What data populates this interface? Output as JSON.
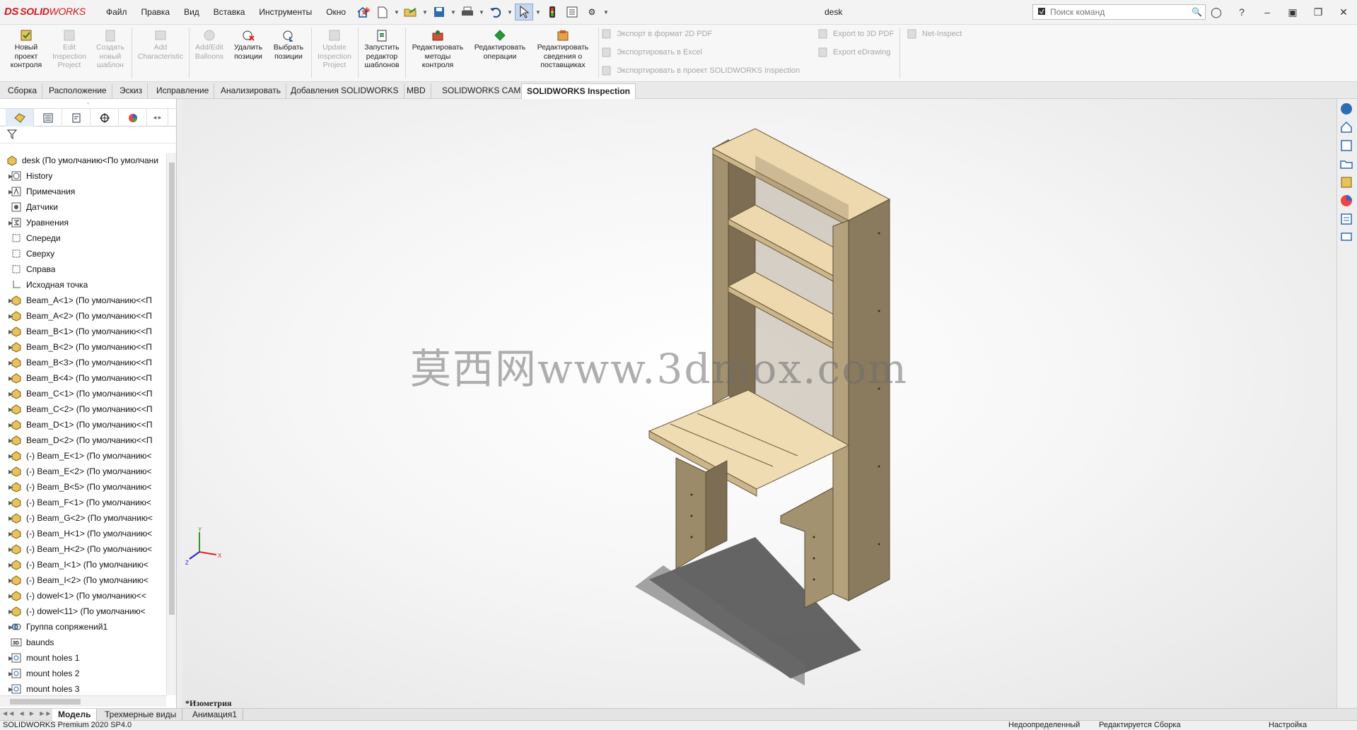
{
  "app": {
    "logo_ds": "DS",
    "logo_solid": "SOLID",
    "logo_works": "WORKS",
    "document_title": "desk"
  },
  "menu": [
    "Файл",
    "Правка",
    "Вид",
    "Вставка",
    "Инструменты",
    "Окно"
  ],
  "search": {
    "placeholder": "Поиск команд"
  },
  "ribbon": {
    "buttons": [
      {
        "label": "Новый\nпроект\nконтроля",
        "enabled": true
      },
      {
        "label": "Edit\nInspection\nProject",
        "enabled": false
      },
      {
        "label": "Создать\nновый\nшаблон",
        "enabled": false
      },
      {
        "label": "Add\nCharacteristic",
        "enabled": false
      },
      {
        "label": "Add/Edit\nBalloons",
        "enabled": false
      },
      {
        "label": "Удалить\nпозиции",
        "enabled": true
      },
      {
        "label": "Выбрать\nпозиции",
        "enabled": true
      },
      {
        "label": "Update\nInspection\nProject",
        "enabled": false
      },
      {
        "label": "Запустить\nредактор\nшаблонов",
        "enabled": true
      },
      {
        "label": "Редактировать\nметоды\nконтроля",
        "enabled": true
      },
      {
        "label": "Редактировать\nоперации",
        "enabled": true
      },
      {
        "label": "Редактировать\nсведения о\nпоставщиках",
        "enabled": true
      }
    ],
    "export_items": [
      "Экспорт в формат 2D PDF",
      "Экспортировать в Excel",
      "Экспортировать в проект SOLIDWORKS Inspection"
    ],
    "export_items_2": [
      "Export to 3D PDF",
      "Export eDrawing"
    ],
    "net_inspect": "Net-Inspect"
  },
  "tabs": [
    {
      "label": "Сборка",
      "active": false
    },
    {
      "label": "Расположение",
      "active": false
    },
    {
      "label": "Эскиз",
      "active": false
    },
    {
      "label": "Исправление",
      "active": false
    },
    {
      "label": "Анализировать",
      "active": false
    },
    {
      "label": "Добавления SOLIDWORKS",
      "active": false
    },
    {
      "label": "MBD",
      "active": false
    },
    {
      "label": "SOLIDWORKS CAM",
      "active": false
    },
    {
      "label": "SOLIDWORKS Inspection",
      "active": true
    }
  ],
  "tree": {
    "root": "desk  (По умолчанию<По умолчани",
    "items": [
      {
        "label": "History",
        "icon": "history-icon",
        "arrow": true
      },
      {
        "label": "Примечания",
        "icon": "annotations-icon",
        "arrow": true
      },
      {
        "label": "Датчики",
        "icon": "sensor-icon",
        "arrow": false
      },
      {
        "label": "Уравнения",
        "icon": "equations-icon",
        "arrow": true
      },
      {
        "label": "Спереди",
        "icon": "plane-icon",
        "arrow": false
      },
      {
        "label": "Сверху",
        "icon": "plane-icon",
        "arrow": false
      },
      {
        "label": "Справа",
        "icon": "plane-icon",
        "arrow": false
      },
      {
        "label": "Исходная точка",
        "icon": "origin-icon",
        "arrow": false
      },
      {
        "label": "Beam_A<1> (По умолчанию<<П",
        "icon": "part-icon",
        "arrow": true
      },
      {
        "label": "Beam_A<2> (По умолчанию<<П",
        "icon": "part-icon",
        "arrow": true
      },
      {
        "label": "Beam_B<1> (По умолчанию<<П",
        "icon": "part-icon",
        "arrow": true
      },
      {
        "label": "Beam_B<2> (По умолчанию<<П",
        "icon": "part-icon",
        "arrow": true
      },
      {
        "label": "Beam_B<3> (По умолчанию<<П",
        "icon": "part-icon",
        "arrow": true
      },
      {
        "label": "Beam_B<4> (По умолчанию<<П",
        "icon": "part-icon",
        "arrow": true
      },
      {
        "label": "Beam_C<1> (По умолчанию<<П",
        "icon": "part-icon",
        "arrow": true
      },
      {
        "label": "Beam_C<2> (По умолчанию<<П",
        "icon": "part-icon",
        "arrow": true
      },
      {
        "label": "Beam_D<1> (По умолчанию<<П",
        "icon": "part-icon",
        "arrow": true
      },
      {
        "label": "Beam_D<2> (По умолчанию<<П",
        "icon": "part-icon",
        "arrow": true
      },
      {
        "label": "(-) Beam_E<1> (По умолчанию<",
        "icon": "part-icon",
        "arrow": true
      },
      {
        "label": "(-) Beam_E<2> (По умолчанию<",
        "icon": "part-icon",
        "arrow": true
      },
      {
        "label": "(-) Beam_B<5> (По умолчанию<",
        "icon": "part-icon",
        "arrow": true
      },
      {
        "label": "(-) Beam_F<1> (По умолчанию<",
        "icon": "part-icon",
        "arrow": true
      },
      {
        "label": "(-) Beam_G<2> (По умолчанию<",
        "icon": "part-icon",
        "arrow": true
      },
      {
        "label": "(-) Beam_H<1> (По умолчанию<",
        "icon": "part-icon",
        "arrow": true
      },
      {
        "label": "(-) Beam_H<2> (По умолчанию<",
        "icon": "part-icon",
        "arrow": true
      },
      {
        "label": "(-) Beam_I<1> (По умолчанию<",
        "icon": "part-icon",
        "arrow": true
      },
      {
        "label": "(-) Beam_I<2> (По умолчанию<",
        "icon": "part-icon",
        "arrow": true
      },
      {
        "label": "(-) dowel<1> (По умолчанию<<",
        "icon": "part-icon",
        "arrow": true
      },
      {
        "label": "(-) dowel<11> (По умолчанию<",
        "icon": "part-icon",
        "arrow": true
      },
      {
        "label": "Группа сопряжений1",
        "icon": "mates-icon",
        "arrow": true
      },
      {
        "label": "baunds",
        "icon": "sketch3d-icon",
        "arrow": false
      },
      {
        "label": "mount holes 1",
        "icon": "feature-icon",
        "arrow": true
      },
      {
        "label": "mount holes 2",
        "icon": "feature-icon",
        "arrow": true
      },
      {
        "label": "mount holes 3",
        "icon": "feature-icon",
        "arrow": true
      }
    ]
  },
  "viewport": {
    "view_label": "*Изометрия",
    "watermark": "莫西网www.3dmox.com"
  },
  "bottom_tabs": [
    {
      "label": "Модель",
      "active": true
    },
    {
      "label": "Трехмерные виды",
      "active": false
    },
    {
      "label": "Анимация1",
      "active": false
    }
  ],
  "status": {
    "product": "SOLIDWORKS Premium 2020 SP4.0",
    "definition": "Недоопределенный",
    "editing": "Редактируется Сборка",
    "settings": "Настройка"
  },
  "colors": {
    "brand_red": "#d0171c",
    "wood_top": "#ecd9b0",
    "wood_side": "#8a7a5e",
    "active_tab_bg": "#ffffff"
  }
}
